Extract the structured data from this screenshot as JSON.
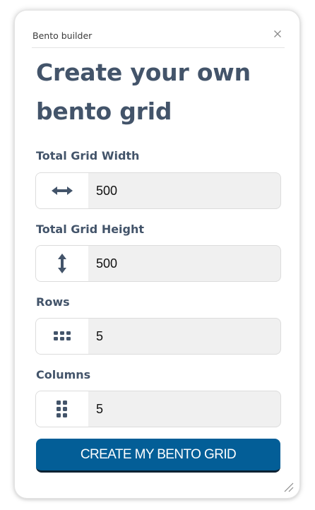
{
  "dialog": {
    "title": "Bento builder",
    "heading_line1": "Create your own",
    "heading_line2": "bento grid"
  },
  "fields": [
    {
      "label": "Total Grid Width",
      "value": "500",
      "icon": "arrows-horizontal-icon"
    },
    {
      "label": "Total Grid Height",
      "value": "500",
      "icon": "arrows-vertical-icon"
    },
    {
      "label": "Rows",
      "value": "5",
      "icon": "grid-rows-icon"
    },
    {
      "label": "Columns",
      "value": "5",
      "icon": "grid-columns-icon"
    }
  ],
  "submit": {
    "label": "CREATE MY BENTO GRID"
  },
  "colors": {
    "heading": "#43546a",
    "button": "#035e97",
    "icon": "#43546a"
  }
}
